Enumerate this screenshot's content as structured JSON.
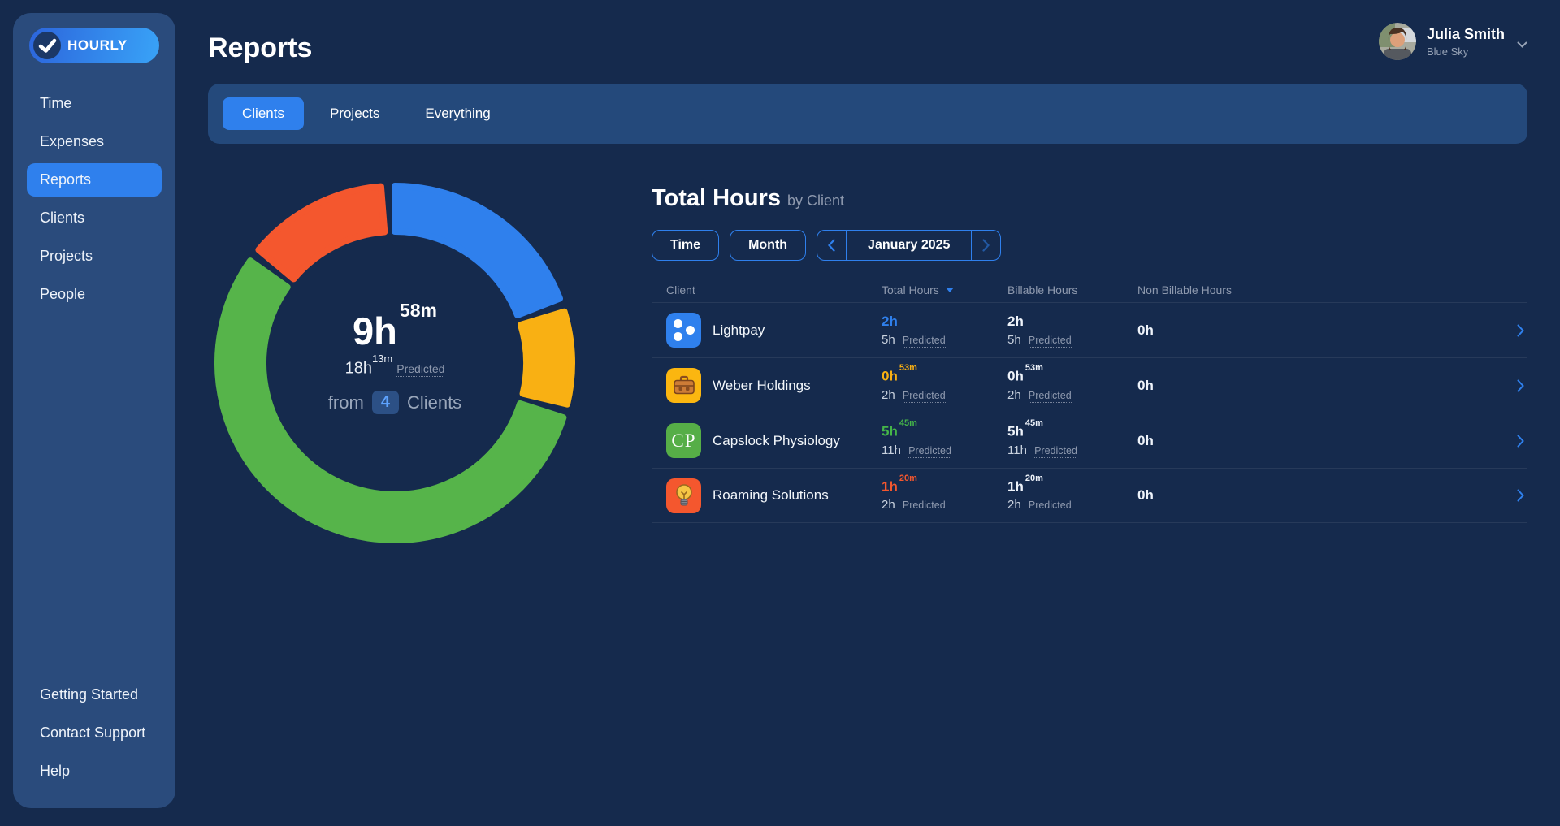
{
  "app": {
    "name": "HOURLY"
  },
  "colors": {
    "accent": "#2f80ed",
    "background": "#152a4d",
    "panel": "#2a4b7c",
    "yellow": "#f9b013",
    "green": "#56b44a",
    "orange": "#f4572e"
  },
  "sidebar": {
    "items": [
      {
        "label": "Time",
        "active": false
      },
      {
        "label": "Expenses",
        "active": false
      },
      {
        "label": "Reports",
        "active": true
      },
      {
        "label": "Clients",
        "active": false
      },
      {
        "label": "Projects",
        "active": false
      },
      {
        "label": "People",
        "active": false
      }
    ],
    "footer_items": [
      {
        "label": "Getting Started"
      },
      {
        "label": "Contact Support"
      },
      {
        "label": "Help"
      }
    ]
  },
  "header": {
    "title": "Reports",
    "user": {
      "name": "Julia Smith",
      "company": "Blue Sky"
    }
  },
  "tabs": [
    {
      "label": "Clients",
      "active": true
    },
    {
      "label": "Projects",
      "active": false
    },
    {
      "label": "Everything",
      "active": false
    }
  ],
  "report": {
    "title": "Total Hours",
    "subtitle": "by Client",
    "controls": {
      "time": "Time",
      "period": "Month",
      "date": "January 2025"
    },
    "summary": {
      "hours": "9h",
      "minutes": "58m",
      "predicted_hours": "18h",
      "predicted_minutes": "13m",
      "predicted_label": "Predicted",
      "from_label": "from",
      "client_count": "4",
      "clients_label": "Clients"
    }
  },
  "table": {
    "columns": [
      "Client",
      "Total Hours",
      "Billable Hours",
      "Non Billable Hours"
    ],
    "sorted_column": "Total Hours",
    "predicted_label": "Predicted",
    "rows": [
      {
        "name": "Lightpay",
        "icon": "dots",
        "accent": "#2f80ed",
        "total": {
          "value": "2h",
          "sup": "",
          "predicted": "5h"
        },
        "billable": {
          "value": "2h",
          "sup": "",
          "predicted": "5h"
        },
        "non_billable": "0h"
      },
      {
        "name": "Weber Holdings",
        "icon": "briefcase",
        "accent": "#f9b013",
        "total": {
          "value": "0h",
          "sup": "53m",
          "predicted": "2h"
        },
        "billable": {
          "value": "0h",
          "sup": "53m",
          "predicted": "2h"
        },
        "non_billable": "0h"
      },
      {
        "name": "Capslock Physiology",
        "icon": "cp-monogram",
        "accent": "#45b649",
        "total": {
          "value": "5h",
          "sup": "45m",
          "predicted": "11h"
        },
        "billable": {
          "value": "5h",
          "sup": "45m",
          "predicted": "11h"
        },
        "non_billable": "0h"
      },
      {
        "name": "Roaming Solutions",
        "icon": "lightbulb",
        "accent": "#f4572e",
        "total": {
          "value": "1h",
          "sup": "20m",
          "predicted": "2h"
        },
        "billable": {
          "value": "1h",
          "sup": "20m",
          "predicted": "2h"
        },
        "non_billable": "0h"
      }
    ]
  },
  "chart_data": {
    "type": "pie",
    "donut": true,
    "title": "Total Hours by Client",
    "period": "January 2025",
    "center_total": "9h 58m",
    "center_predicted": "18h 13m Predicted",
    "center_from": "from 4 Clients",
    "total_minutes": 598,
    "start": "top",
    "direction": "clockwise",
    "segments": [
      {
        "label": "Lightpay",
        "minutes": 120,
        "hours_display": "2h",
        "color": "#2f80ed"
      },
      {
        "label": "Weber Holdings",
        "minutes": 53,
        "hours_display": "0h 53m",
        "color": "#f9b013"
      },
      {
        "label": "Capslock Physiology",
        "minutes": 345,
        "hours_display": "5h 45m",
        "color": "#56b44a"
      },
      {
        "label": "Roaming Solutions",
        "minutes": 80,
        "hours_display": "1h 20m",
        "color": "#f4572e"
      }
    ]
  }
}
